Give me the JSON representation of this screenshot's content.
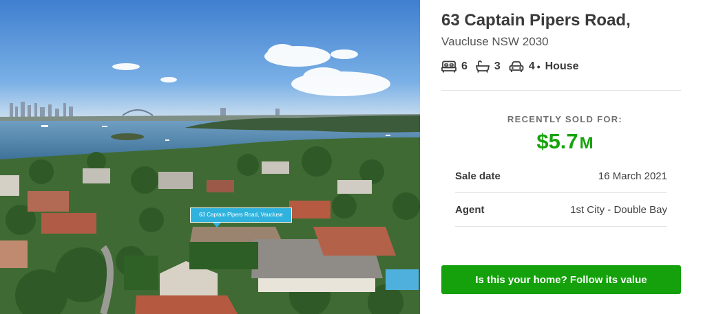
{
  "photo": {
    "map_tag": "63 Captain Pipers Road, Vaucluse"
  },
  "listing": {
    "address_line1": "63 Captain Pipers Road,",
    "address_line2": "Vaucluse NSW 2030",
    "features": {
      "bedrooms": "6",
      "bathrooms": "3",
      "parking": "4",
      "separator": "•",
      "property_type": "House"
    },
    "icons": [
      "bed-icon",
      "bath-icon",
      "car-icon"
    ]
  },
  "sale": {
    "label": "RECENTLY SOLD FOR:",
    "price_amount": "$5.7",
    "price_unit": "M",
    "rows": [
      {
        "key": "Sale date",
        "value": "16 March 2021"
      },
      {
        "key": "Agent",
        "value": "1st City - Double Bay"
      }
    ]
  },
  "cta": {
    "label": "Is this your home? Follow its value"
  },
  "colors": {
    "price_green": "#17a30c",
    "button_green": "#14a10b",
    "map_tag_blue": "#2fb3de"
  }
}
